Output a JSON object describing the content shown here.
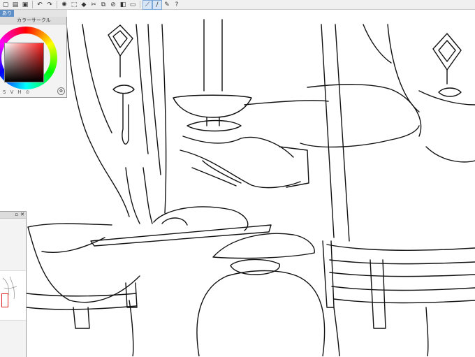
{
  "toolbar": {
    "icons": [
      "new-file-icon",
      "open-folder-icon",
      "save-icon",
      "undo-icon",
      "redo-icon",
      "clear-icon",
      "transform-icon",
      "fill-icon",
      "cut-icon",
      "copy-icon",
      "deselect-icon",
      "invert-icon",
      "ruler-icon",
      "snap-icon",
      "line-icon",
      "help-icon"
    ]
  },
  "tab": {
    "label": "あり"
  },
  "color_panel": {
    "title": "カラーサークル",
    "footer": [
      "S",
      "V",
      "H",
      "⊙"
    ],
    "colors": {
      "main": "#ff1a1a"
    }
  },
  "navigator": {
    "buttons": [
      "▫",
      "✕"
    ]
  },
  "colors": {
    "accent": "#5d8ec7",
    "selection_red": "#e02020"
  }
}
